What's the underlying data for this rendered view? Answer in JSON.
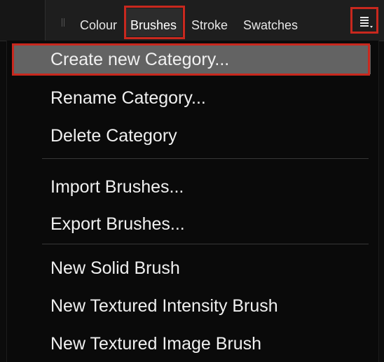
{
  "tabs": [
    {
      "label": "Colour",
      "active": false
    },
    {
      "label": "Brushes",
      "active": true
    },
    {
      "label": "Stroke",
      "active": false
    },
    {
      "label": "Swatches",
      "active": false
    }
  ],
  "menu_button": {
    "icon": "hamburger-menu-icon"
  },
  "menu": {
    "groups": [
      {
        "items": [
          {
            "label": "Create new Category...",
            "hovered": true
          },
          {
            "label": "Rename Category..."
          },
          {
            "label": "Delete Category"
          }
        ]
      },
      {
        "items": [
          {
            "label": "Import Brushes..."
          },
          {
            "label": "Export Brushes..."
          }
        ]
      },
      {
        "items": [
          {
            "label": "New Solid Brush"
          },
          {
            "label": "New Textured Intensity Brush"
          },
          {
            "label": "New Textured Image Brush"
          }
        ]
      }
    ]
  },
  "colors": {
    "panel_bg": "#0c0c0c",
    "tabbar_bg": "#1e1e1e",
    "hover_bg": "#636363",
    "highlight": "#c8281e",
    "text": "#f0f0f0"
  }
}
